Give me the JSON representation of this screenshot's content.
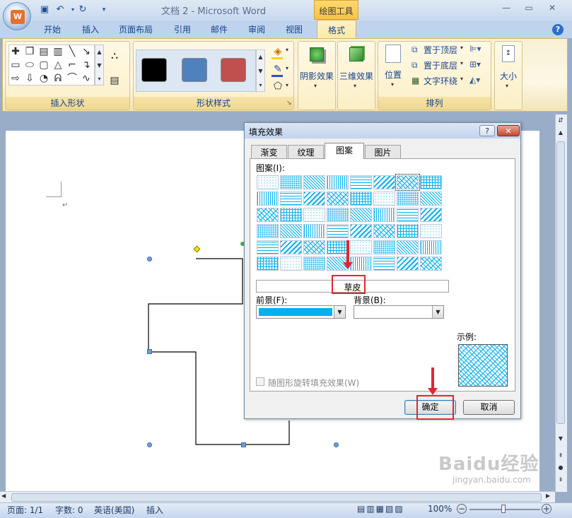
{
  "window": {
    "doc_title": "文档 2 - Microsoft Word",
    "context_group": "绘图工具",
    "office_logo": "W",
    "qat_icons": [
      "save-icon",
      "undo-icon",
      "undo-dropdown-icon",
      "redo-icon",
      "customize-qat-icon"
    ],
    "controls": [
      "minimize-icon",
      "restore-icon",
      "close-icon"
    ]
  },
  "ribbon": {
    "tabs": [
      "开始",
      "插入",
      "页面布局",
      "引用",
      "邮件",
      "审阅",
      "视图",
      "格式"
    ],
    "active_tab": "格式",
    "groups": {
      "insert_shapes": "插入形状",
      "shape_styles": "形状样式",
      "shadow": "阴影效果",
      "threed": "三维效果",
      "arrange": "排列",
      "size": "大小"
    },
    "arrange_items": {
      "bring_front": "置于顶层",
      "send_back": "置于底层",
      "text_wrap": "文字环绕",
      "position": "位置"
    },
    "style_colors": [
      "#000000",
      "#4f81bd",
      "#c0504d"
    ]
  },
  "dialog": {
    "title": "填充效果",
    "tabs": [
      "渐变",
      "纹理",
      "图案",
      "图片"
    ],
    "active_tab": "图案",
    "pattern_label": "图案(I):",
    "selected_pattern": "草皮",
    "foreground_label": "前景(F):",
    "background_label": "背景(B):",
    "foreground_color": "#00b0f0",
    "background_color": "#ffffff",
    "sample_label": "示例:",
    "rotate_label": "随图形旋转填充效果(W)",
    "ok": "确定",
    "cancel": "取消",
    "help_glyph": "?",
    "close_glyph": "✕"
  },
  "statusbar": {
    "page": "页面: 1/1",
    "words": "字数: 0",
    "language": "英语(美国)",
    "mode": "插入",
    "zoom": "100%"
  },
  "watermark": {
    "brand": "Baidu经验",
    "url": "jingyan.baidu.com"
  }
}
